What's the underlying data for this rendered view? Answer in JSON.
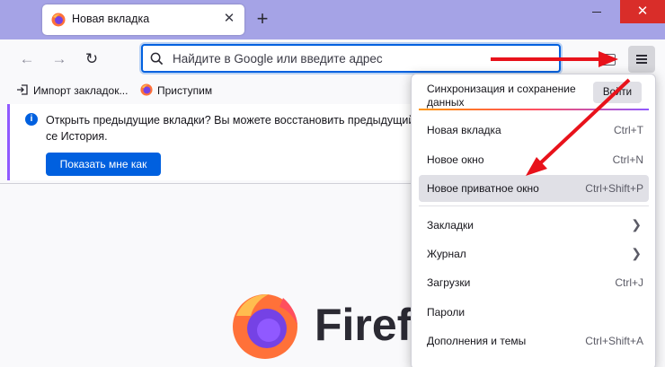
{
  "tab": {
    "title": "Новая вкладка",
    "close_glyph": "✕"
  },
  "newtab_glyph": "+",
  "window": {
    "close_glyph": "✕"
  },
  "nav": {
    "back_glyph": "←",
    "forward_glyph": "→",
    "reload_glyph": "↻"
  },
  "urlbar": {
    "placeholder": "Найдите в Google или введите адрес"
  },
  "bookmarks": [
    {
      "label": "Импорт закладок...",
      "icon": "import-icon"
    },
    {
      "label": "Приступим",
      "icon": "firefox-icon"
    }
  ],
  "notification": {
    "message": "Открыть предыдущие вкладки? Вы можете восстановить предыдущий се История.",
    "button": "Показать мне как"
  },
  "content": {
    "brand": "Firefo"
  },
  "menu": {
    "sync_title": "Синхронизация и сохранение данных",
    "sync_button": "Войти",
    "items": [
      {
        "label": "Новая вкладка",
        "shortcut": "Ctrl+T"
      },
      {
        "label": "Новое окно",
        "shortcut": "Ctrl+N"
      },
      {
        "label": "Новое приватное окно",
        "shortcut": "Ctrl+Shift+P"
      },
      {
        "label": "Закладки",
        "shortcut": ""
      },
      {
        "label": "Журнал",
        "shortcut": ""
      },
      {
        "label": "Загрузки",
        "shortcut": "Ctrl+J"
      },
      {
        "label": "Пароли",
        "shortcut": ""
      },
      {
        "label": "Дополнения и темы",
        "shortcut": "Ctrl+Shift+A"
      }
    ]
  },
  "colors": {
    "accent": "#0060df",
    "titlebar": "#a5a3e6",
    "annotation": "#e8121b"
  }
}
